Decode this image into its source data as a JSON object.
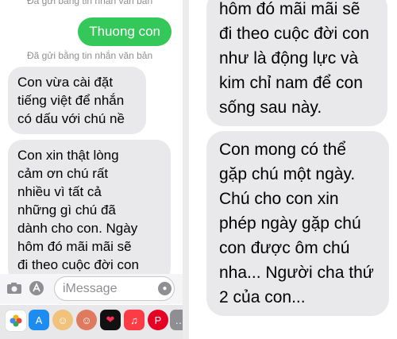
{
  "left": {
    "status_top": "Đã gửi bằng tin nhắn văn bản",
    "sent_message": "Thuong con",
    "status_below": "Đã gửi bằng tin nhắn văn bản",
    "messages": [
      "Con vừa cài đặt\ntiếng việt để nhắn\ncó dấu với chú nề",
      "Con xin thật lòng\ncảm ơn chú rất\nnhiều vì tất cả\nnhững gì chú đã\ndành cho con. Ngày\nhôm đó mãi mãi sẽ\nđi theo cuộc đời con"
    ],
    "input_placeholder": "iMessage",
    "apps": [
      "photos-app-icon",
      "app-store-icon",
      "memoji-icon",
      "memoji-icon-2",
      "digital-touch-icon",
      "music-app-icon",
      "pinterest-app-icon",
      "more-apps-icon"
    ]
  },
  "right": {
    "messages": [
      "hôm đó mãi mãi sẽ\nđi theo cuộc đời con\nnhư là động lực và\nkim chỉ nam để con\nsống sau này.",
      "Con mong có thể\ngặp chú một ngày.\nChú cho con xin\nphép ngày gặp chú\ncon được ôm chú\nnha... Người cha thứ\n2 của con..."
    ]
  },
  "colors": {
    "sent_bubble": "#34c759",
    "received_bubble": "#e9e9eb"
  }
}
